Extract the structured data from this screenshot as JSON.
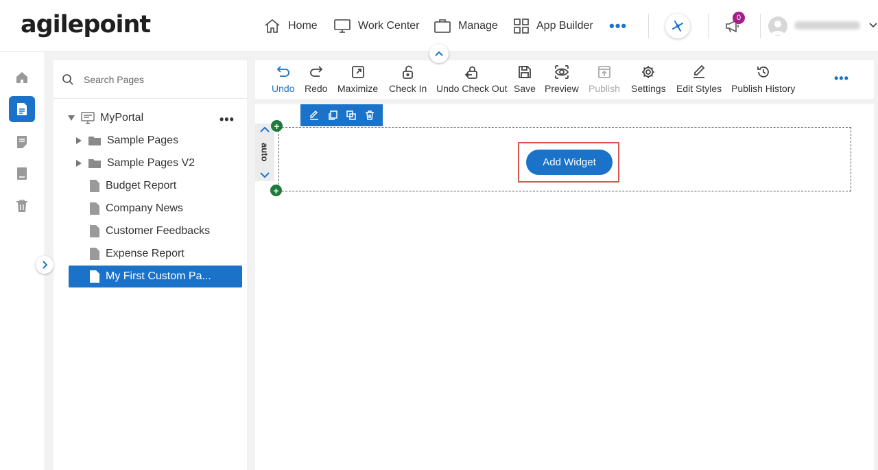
{
  "logo": {
    "text": "agilepoint"
  },
  "nav": {
    "home": "Home",
    "work_center": "Work Center",
    "manage": "Manage",
    "app_builder": "App Builder",
    "more": "•••"
  },
  "notifications": {
    "count": "0"
  },
  "user": {
    "name": ""
  },
  "search": {
    "placeholder": "Search Pages"
  },
  "tree": {
    "root": "MyPortal",
    "root_more": "•••",
    "items": [
      {
        "label": "Sample Pages",
        "type": "folder"
      },
      {
        "label": "Sample Pages V2",
        "type": "folder"
      },
      {
        "label": "Budget Report",
        "type": "page"
      },
      {
        "label": "Company News",
        "type": "page"
      },
      {
        "label": "Customer Feedbacks",
        "type": "page"
      },
      {
        "label": "Expense Report",
        "type": "page"
      },
      {
        "label": "My First Custom Pa...",
        "type": "page",
        "selected": true
      }
    ]
  },
  "toolbar": {
    "undo": "Undo",
    "redo": "Redo",
    "maximize": "Maximize",
    "check_in": "Check In",
    "undo_check_out": "Undo Check Out",
    "save": "Save",
    "preview": "Preview",
    "publish": "Publish",
    "settings": "Settings",
    "edit_styles": "Edit Styles",
    "publish_history": "Publish History",
    "more": "•••"
  },
  "canvas": {
    "row_label": "auto",
    "add_widget": "Add Widget",
    "plus": "+"
  },
  "colors": {
    "accent": "#1a73c9",
    "badge": "#a51e8a",
    "highlight": "#d9534f",
    "plus_green": "#1e7a3a"
  }
}
